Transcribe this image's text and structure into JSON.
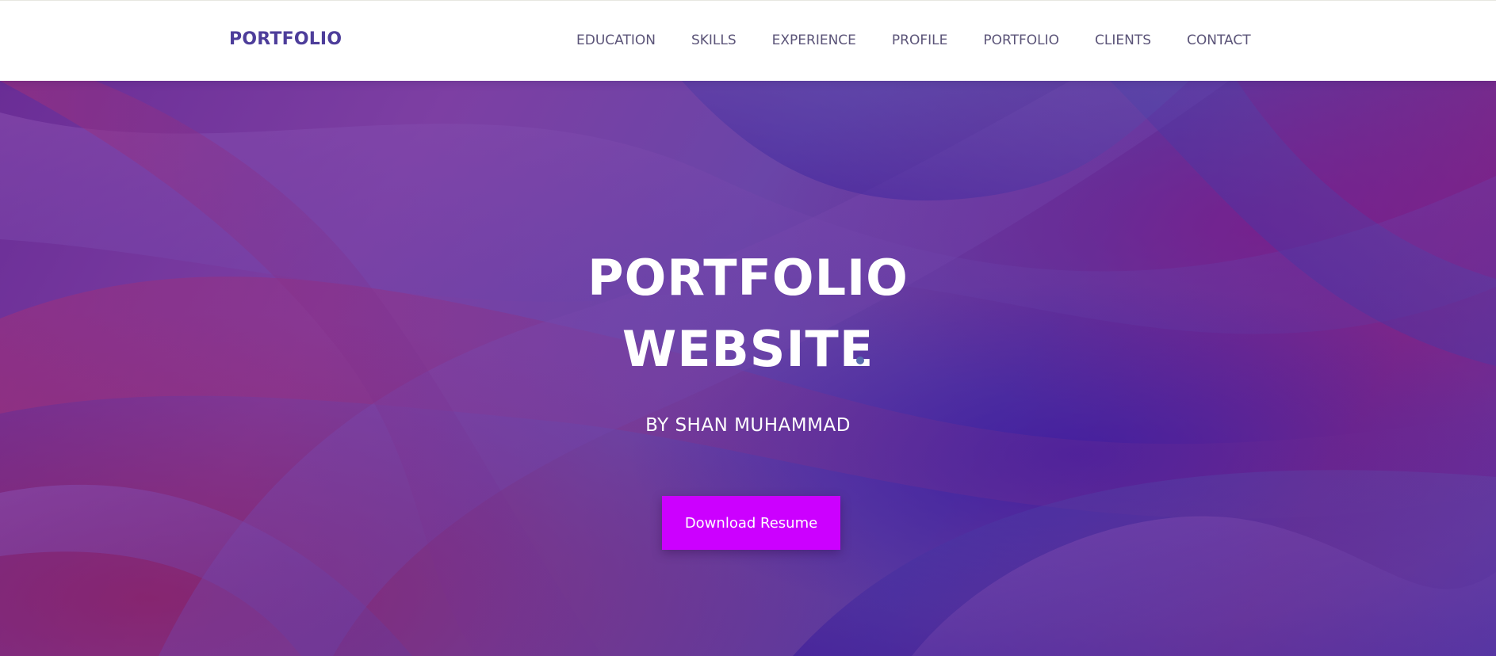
{
  "navbar": {
    "brand": "PORTFOLIO",
    "links": [
      "EDUCATION",
      "SKILLS",
      "EXPERIENCE",
      "PROFILE",
      "PORTFOLIO",
      "CLIENTS",
      "CONTACT"
    ]
  },
  "hero": {
    "title_line1": "PORTFOLIO",
    "title_line2": "WEBSITE",
    "subtitle": "BY SHAN MUHAMMAD",
    "cta_label": "Download Resume"
  },
  "colors": {
    "brand": "#4d3d9a",
    "nav_text": "#5b5478",
    "cta": "#cc00ff"
  }
}
